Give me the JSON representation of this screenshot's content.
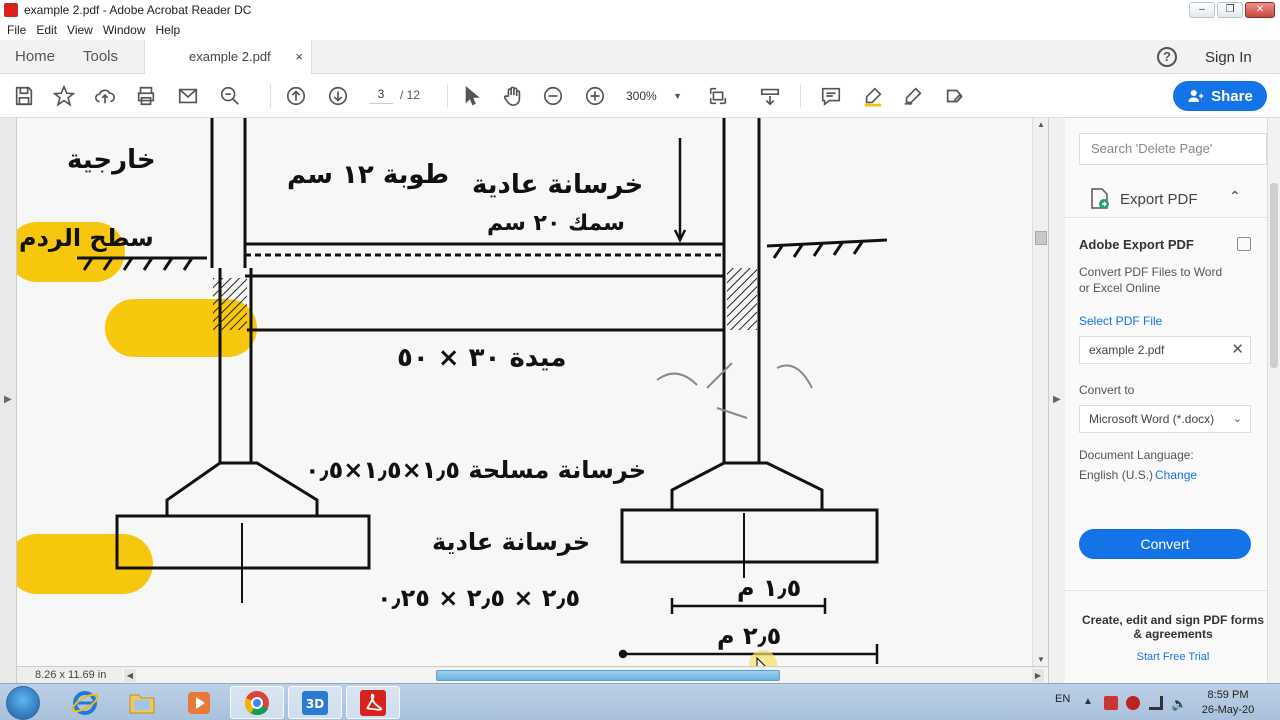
{
  "window": {
    "title": "example 2.pdf - Adobe Acrobat Reader DC"
  },
  "menu": [
    "File",
    "Edit",
    "View",
    "Window",
    "Help"
  ],
  "tabs": {
    "home": "Home",
    "tools": "Tools",
    "document": "example 2.pdf",
    "close": "×"
  },
  "header": {
    "help": "?",
    "sign_in": "Sign In"
  },
  "toolbar": {
    "page_current": "3",
    "page_total": "/ 12",
    "zoom": "300%",
    "share": "Share"
  },
  "document": {
    "page_size": "8.26 x 11.69 in",
    "annotations": [
      "طوبة ١٢ سم",
      "خرسانة عادية",
      "سمك ٢٠ سم",
      "خارجية",
      "سطح الردم",
      "ميدة ٣٠ × ٥٠",
      "خرسانة مسلحة ١٫٥×١٫٥×٠٫٥",
      "خرسانة عادية",
      "٢٫٥ × ٢٫٥ × ٠٫٢٥",
      "١٫٥ م",
      "٢٫٥ م"
    ]
  },
  "right_panel": {
    "search_placeholder": "Search 'Delete Page'",
    "export_label": "Export PDF",
    "adobe_export_title": "Adobe Export PDF",
    "adobe_export_desc": "Convert PDF Files to Word or Excel Online",
    "select_pdf_label": "Select PDF File",
    "selected_file": "example 2.pdf",
    "convert_to_label": "Convert to",
    "convert_to_value": "Microsoft Word (*.docx)",
    "doc_language_label": "Document Language:",
    "doc_language_value": "English (U.S.)",
    "change_link": "Change",
    "convert_button": "Convert",
    "promo_text": "Create, edit and sign PDF forms & agreements",
    "trial_link": "Start Free Trial"
  },
  "taskbar": {
    "language": "EN",
    "time": "8:59 PM",
    "date": "26-May-20"
  },
  "colors": {
    "accent": "#1473e6",
    "highlight": "#f5c400"
  }
}
